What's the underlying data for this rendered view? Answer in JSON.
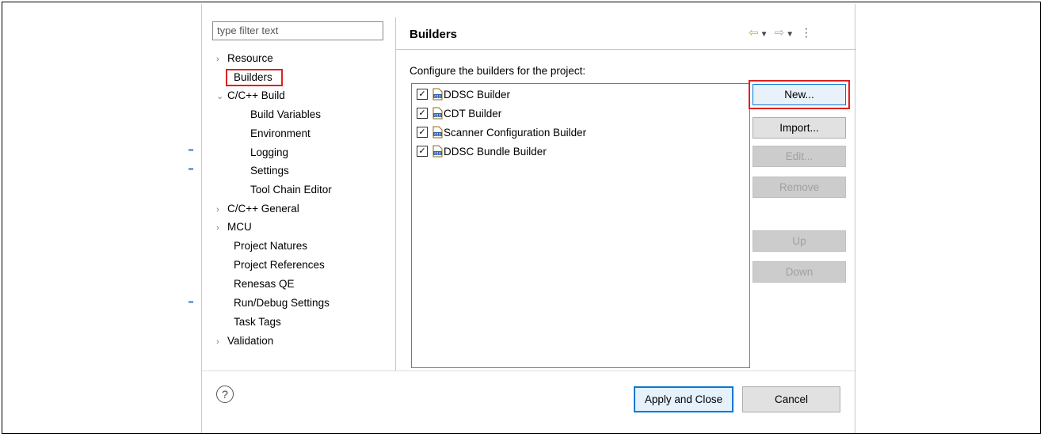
{
  "filter": {
    "placeholder": "type filter text"
  },
  "tree": {
    "items": [
      {
        "label": "Resource",
        "chevron": "›"
      },
      {
        "label": "Builders",
        "chevron": ""
      },
      {
        "label": "C/C++ Build",
        "chevron": "⌄"
      },
      {
        "label": "Build Variables",
        "chevron": ""
      },
      {
        "label": "Environment",
        "chevron": ""
      },
      {
        "label": "Logging",
        "chevron": ""
      },
      {
        "label": "Settings",
        "chevron": ""
      },
      {
        "label": "Tool Chain Editor",
        "chevron": ""
      },
      {
        "label": "C/C++ General",
        "chevron": "›"
      },
      {
        "label": "MCU",
        "chevron": "›"
      },
      {
        "label": "Project Natures",
        "chevron": ""
      },
      {
        "label": "Project References",
        "chevron": ""
      },
      {
        "label": "Renesas QE",
        "chevron": ""
      },
      {
        "label": "Run/Debug Settings",
        "chevron": ""
      },
      {
        "label": "Task Tags",
        "chevron": ""
      },
      {
        "label": "Validation",
        "chevron": "›"
      }
    ]
  },
  "page": {
    "title": "Builders",
    "description": "Configure the builders for the project:"
  },
  "builders": [
    {
      "label": "DDSC Builder",
      "checked": true
    },
    {
      "label": "CDT Builder",
      "checked": true
    },
    {
      "label": "Scanner Configuration Builder",
      "checked": true
    },
    {
      "label": "DDSC Bundle Builder",
      "checked": true
    }
  ],
  "buttons": {
    "new": "New...",
    "import": "Import...",
    "edit": "Edit...",
    "remove": "Remove",
    "up": "Up",
    "down": "Down"
  },
  "footer": {
    "help_glyph": "?",
    "apply_close": "Apply and Close",
    "cancel": "Cancel"
  },
  "nav": {
    "back_icon": "back-arrow-icon",
    "forward_icon": "forward-arrow-icon",
    "menu_icon": "view-menu-icon"
  },
  "colors": {
    "highlight": "#e02020",
    "accent": "#0078d7",
    "nav_back": "#e0a818"
  }
}
